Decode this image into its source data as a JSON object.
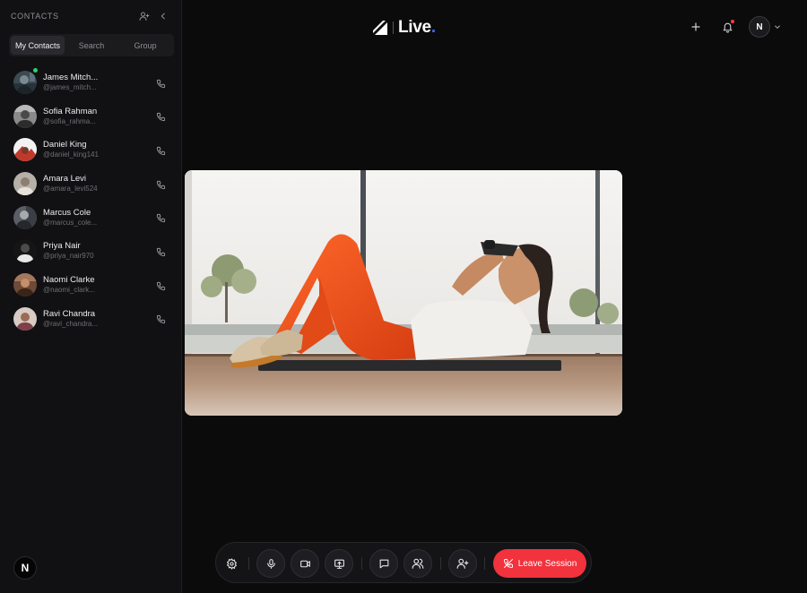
{
  "sidebar": {
    "title": "CONTACTS",
    "tabs": [
      {
        "label": "My Contacts",
        "active": true
      },
      {
        "label": "Search",
        "active": false
      },
      {
        "label": "Group",
        "active": false
      }
    ],
    "contacts": [
      {
        "name": "James Mitch...",
        "handle": "@james_mitch...",
        "online": true
      },
      {
        "name": "Sofia Rahman",
        "handle": "@sofia_rahma...",
        "online": false
      },
      {
        "name": "Daniel King",
        "handle": "@daniel_king141",
        "online": false
      },
      {
        "name": "Amara Levi",
        "handle": "@amara_levi524",
        "online": false
      },
      {
        "name": "Marcus Cole",
        "handle": "@marcus_cole...",
        "online": false
      },
      {
        "name": "Priya Nair",
        "handle": "@priya_nair970",
        "online": false
      },
      {
        "name": "Naomi Clarke",
        "handle": "@naomi_clark...",
        "online": false
      },
      {
        "name": "Ravi Chandra",
        "handle": "@ravi_chandra...",
        "online": false
      }
    ],
    "brand_badge": "N"
  },
  "header": {
    "logo_text": "Live",
    "logo_dot": ".",
    "user_initial": "N"
  },
  "controls": {
    "leave_label": "Leave Session"
  },
  "colors": {
    "accent": "#3b6cf6",
    "leave": "#f2323c",
    "online": "#2fcf6a",
    "notification": "#ff3b3b"
  }
}
